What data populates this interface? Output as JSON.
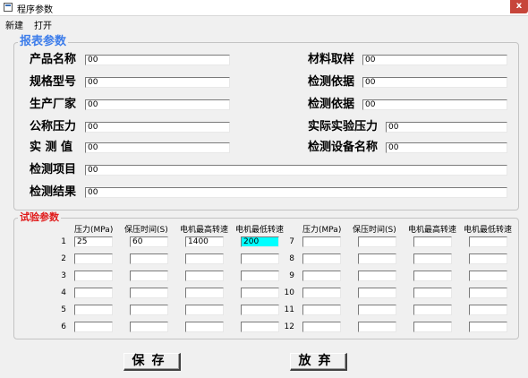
{
  "window": {
    "title": "程序参数",
    "close_glyph": "x"
  },
  "menu": {
    "new": "新建",
    "open": "打开"
  },
  "report": {
    "legend": "报表参数",
    "product_name": {
      "label": "产品名称",
      "value": "00"
    },
    "spec_model": {
      "label": "规格型号",
      "value": "00"
    },
    "manufacturer": {
      "label": "生产厂家",
      "value": "00"
    },
    "nominal_pressure": {
      "label": "公称压力",
      "value": "00"
    },
    "measured_value": {
      "label": "实 测 值",
      "value": "00"
    },
    "test_item": {
      "label": "检测项目",
      "value": "00"
    },
    "test_result": {
      "label": "检测结果",
      "value": "00"
    },
    "material_sampling": {
      "label": "材料取样",
      "value": "00"
    },
    "test_basis_1": {
      "label": "检测依据",
      "value": "00"
    },
    "test_basis_2": {
      "label": "检测依据",
      "value": "00"
    },
    "actual_test_pressure": {
      "label": "实际实验压力",
      "value": "00"
    },
    "test_equipment_name": {
      "label": "检测设备名称",
      "value": "00"
    }
  },
  "test": {
    "legend": "试验参数",
    "headers": [
      "压力(MPa)",
      "保压时间(S)",
      "电机最高转速",
      "电机最低转速"
    ],
    "left_rows": [
      {
        "n": "1",
        "cells": [
          "25",
          "60",
          "1400",
          "200"
        ]
      },
      {
        "n": "2",
        "cells": [
          "",
          "",
          "",
          ""
        ]
      },
      {
        "n": "3",
        "cells": [
          "",
          "",
          "",
          ""
        ]
      },
      {
        "n": "4",
        "cells": [
          "",
          "",
          "",
          ""
        ]
      },
      {
        "n": "5",
        "cells": [
          "",
          "",
          "",
          ""
        ]
      },
      {
        "n": "6",
        "cells": [
          "",
          "",
          "",
          ""
        ]
      }
    ],
    "right_rows": [
      {
        "n": "7",
        "cells": [
          "",
          "",
          "",
          ""
        ]
      },
      {
        "n": "8",
        "cells": [
          "",
          "",
          "",
          ""
        ]
      },
      {
        "n": "9",
        "cells": [
          "",
          "",
          "",
          ""
        ]
      },
      {
        "n": "10",
        "cells": [
          "",
          "",
          "",
          ""
        ]
      },
      {
        "n": "11",
        "cells": [
          "",
          "",
          "",
          ""
        ]
      },
      {
        "n": "12",
        "cells": [
          "",
          "",
          "",
          ""
        ]
      }
    ],
    "highlight_color": "#00ffff"
  },
  "buttons": {
    "save": "保存",
    "discard": "放弃"
  }
}
